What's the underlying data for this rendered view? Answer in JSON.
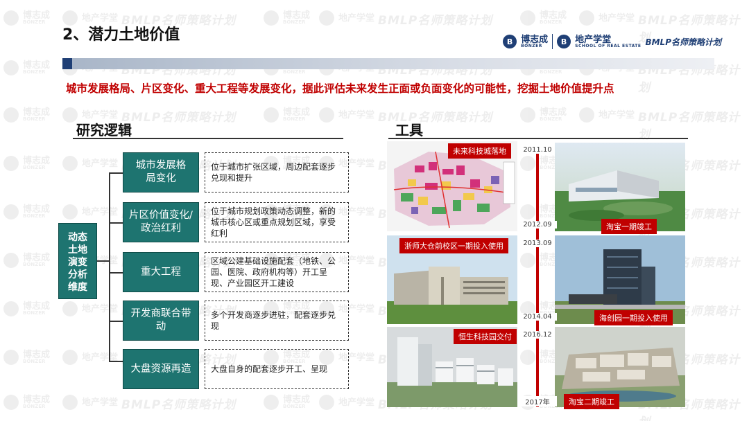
{
  "header": {
    "title": "2、潜力土地价值",
    "brand": {
      "company": "博志成",
      "company_en": "BONZER",
      "school": "地产学堂",
      "school_en": "SCHOOL OF REAL ESTATE",
      "program": "BMLP名师策略计划"
    }
  },
  "subtitle": "城市发展格局、片区变化、重大工程等发展变化，据此评估未来发生正面或负面变化的可能性，挖掘土地价值提升点",
  "logic": {
    "heading": "研究逻辑",
    "core_lines": [
      "动态",
      "土地",
      "演变",
      "分析",
      "维度"
    ],
    "items": [
      {
        "label": "城市发展格局变化",
        "desc": "位于城市扩张区域，周边配套逐步兑现和提升"
      },
      {
        "label": "片区价值变化/政治红利",
        "desc": "位于城市规划政策动态调整，新的城市核心区或重点规划区域，享受红利"
      },
      {
        "label": "重大工程",
        "desc": "区域公建基础设施配套（地铁、公园、医院、政府机构等）开工呈现、产业园区开工建设"
      },
      {
        "label": "开发商联合带动",
        "desc": "多个开发商逐步进驻，配套逐步兑现"
      },
      {
        "label": "大盘资源再造",
        "desc": "大盘自身的配套逐步开工、呈现"
      }
    ]
  },
  "tools": {
    "heading": "工具",
    "events": [
      {
        "tag": "未来科技城落地",
        "year": "2011.10"
      },
      {
        "tag": "淘宝一期竣工",
        "year": "2012.09"
      },
      {
        "tag": "浙师大仓前校区一期投入使用",
        "year": "2013.09"
      },
      {
        "tag": "海创园一期投入使用",
        "year": "2014.04"
      },
      {
        "tag": "恒生科技园交付",
        "year": "2016.12"
      },
      {
        "tag": "淘宝二期竣工",
        "year": "2017年"
      }
    ]
  },
  "watermark": {
    "company": "博志成",
    "company_en": "BONZER",
    "school": "地产学堂",
    "program": "BMLP名师策略计划"
  },
  "colors": {
    "accent_red": "#c00000",
    "teal": "#1e7470",
    "navy": "#1f3f75"
  }
}
